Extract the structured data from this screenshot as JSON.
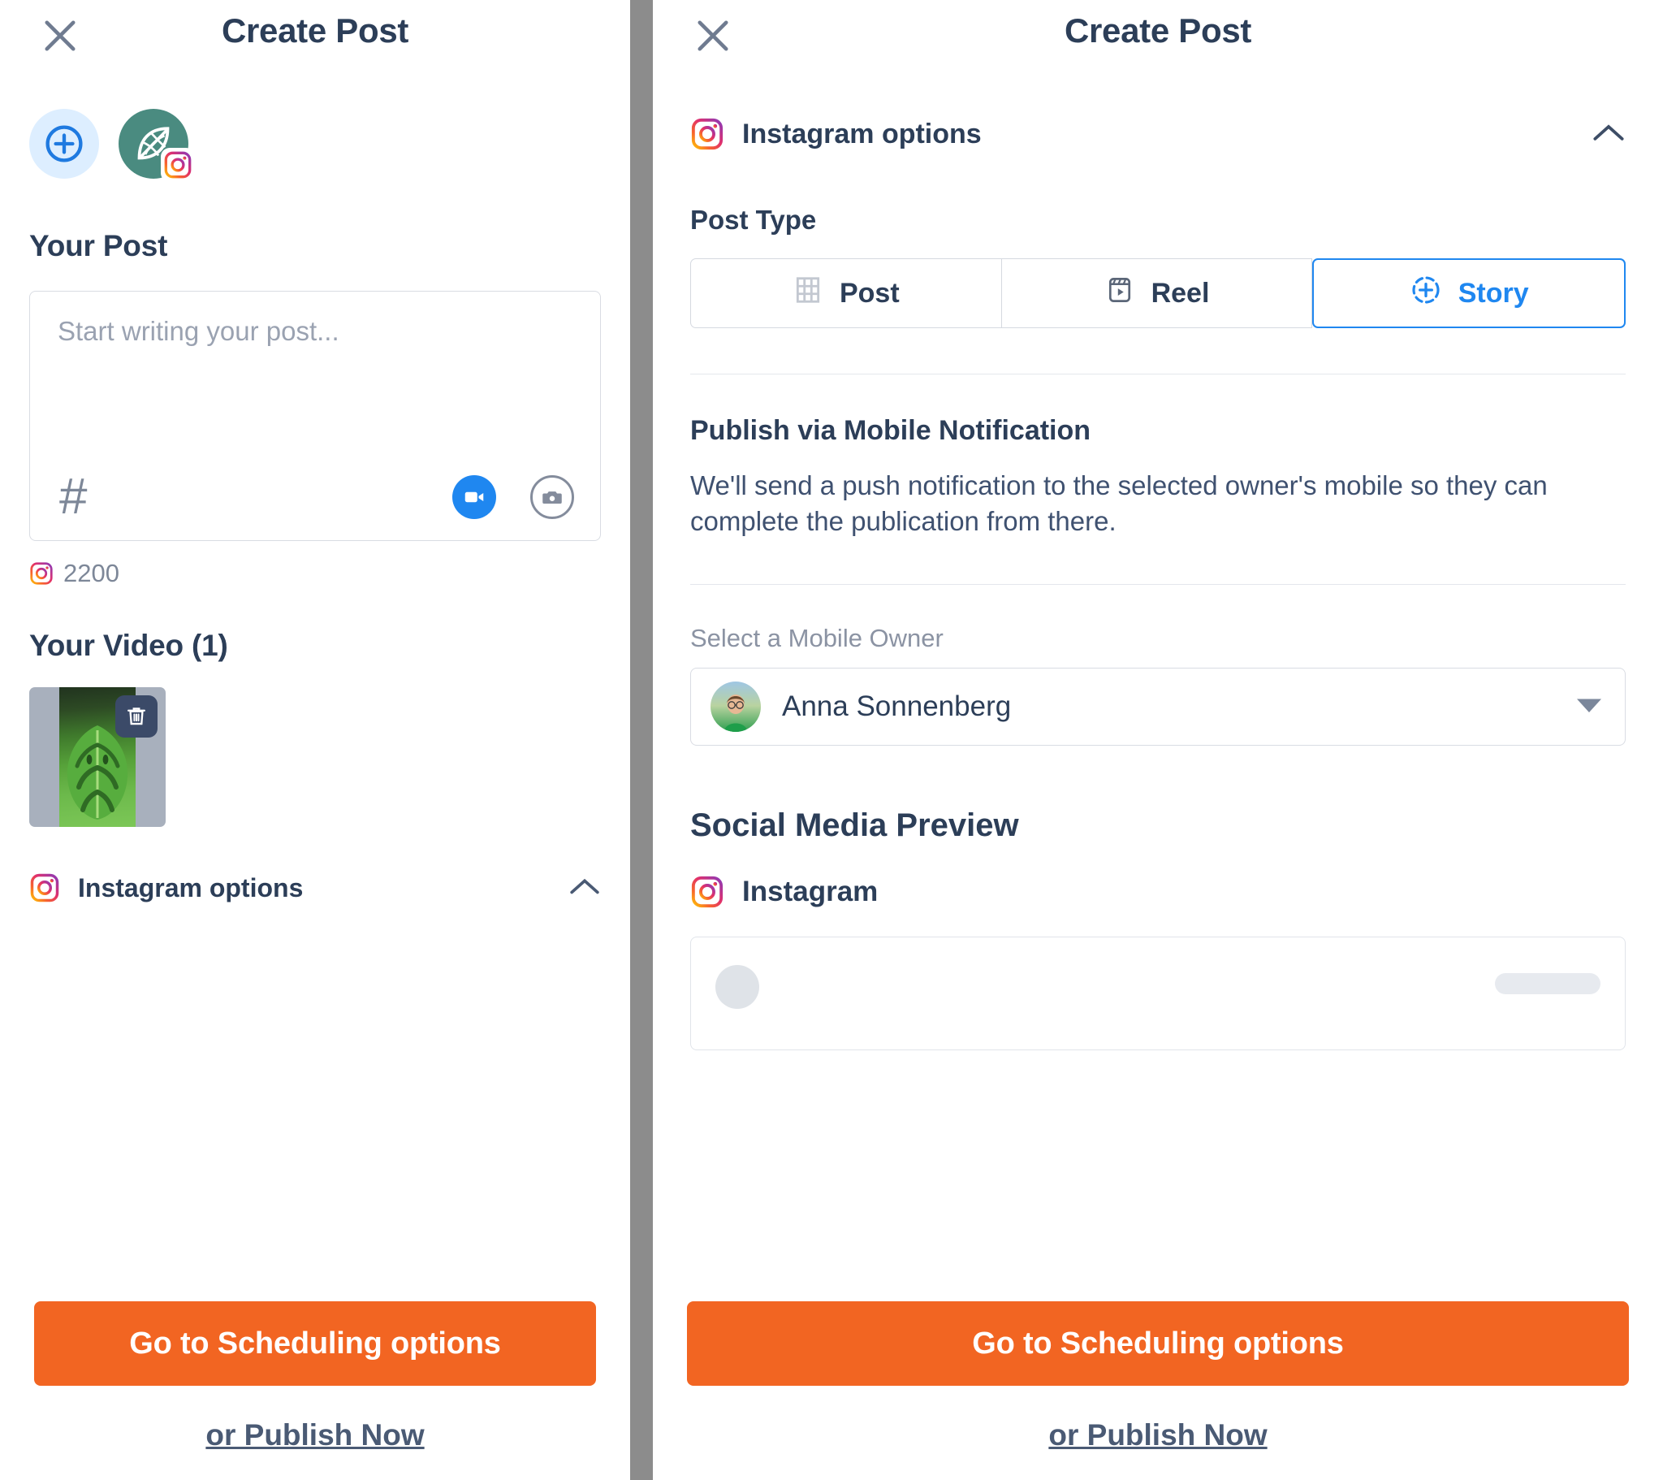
{
  "left": {
    "header": {
      "title": "Create Post",
      "close_icon": "close-icon"
    },
    "accounts": {
      "add_icon": "plus-circle-icon",
      "profile_icon": "leaf-avatar-icon",
      "badge_icon": "instagram-icon"
    },
    "your_post": {
      "heading": "Your Post",
      "placeholder": "Start writing your post...",
      "value": "",
      "hashtag_icon": "hashtag-icon",
      "video_icon": "video-camera-icon",
      "camera_icon": "camera-icon",
      "char_count": "2200",
      "char_count_icon": "instagram-icon"
    },
    "your_video": {
      "heading": "Your Video (1)",
      "delete_icon": "trash-icon"
    },
    "options_row": {
      "label": "Instagram options",
      "icon": "instagram-icon",
      "chevron": "chevron-up-icon"
    },
    "footer": {
      "cta_label": "Go to Scheduling options",
      "publish_now_label": "or Publish Now"
    }
  },
  "right": {
    "header": {
      "title": "Create Post",
      "close_icon": "close-icon"
    },
    "options_row": {
      "label": "Instagram options",
      "icon": "instagram-icon",
      "chevron": "chevron-up-icon"
    },
    "post_type": {
      "heading": "Post Type",
      "options": [
        {
          "label": "Post",
          "icon": "grid-icon",
          "selected": false
        },
        {
          "label": "Reel",
          "icon": "reel-play-icon",
          "selected": false
        },
        {
          "label": "Story",
          "icon": "story-plus-icon",
          "selected": true
        }
      ],
      "selected": "Story"
    },
    "mobile_notification": {
      "heading": "Publish via Mobile Notification",
      "description": "We'll send a push notification to the selected owner's mobile so they can complete the publication from there.",
      "field_label": "Select a Mobile Owner",
      "selected_owner": "Anna Sonnenberg",
      "caret_icon": "caret-down-icon",
      "avatar_icon": "user-avatar"
    },
    "preview": {
      "heading": "Social Media Preview",
      "network_label": "Instagram",
      "network_icon": "instagram-icon"
    },
    "footer": {
      "cta_label": "Go to Scheduling options",
      "publish_now_label": "or Publish Now"
    }
  },
  "colors": {
    "accent_orange": "#f26522",
    "brand_blue": "#1f87f0",
    "heading_navy": "#2c3e58",
    "muted_gray": "#7d8798",
    "avatar_teal": "#4a8b80"
  }
}
